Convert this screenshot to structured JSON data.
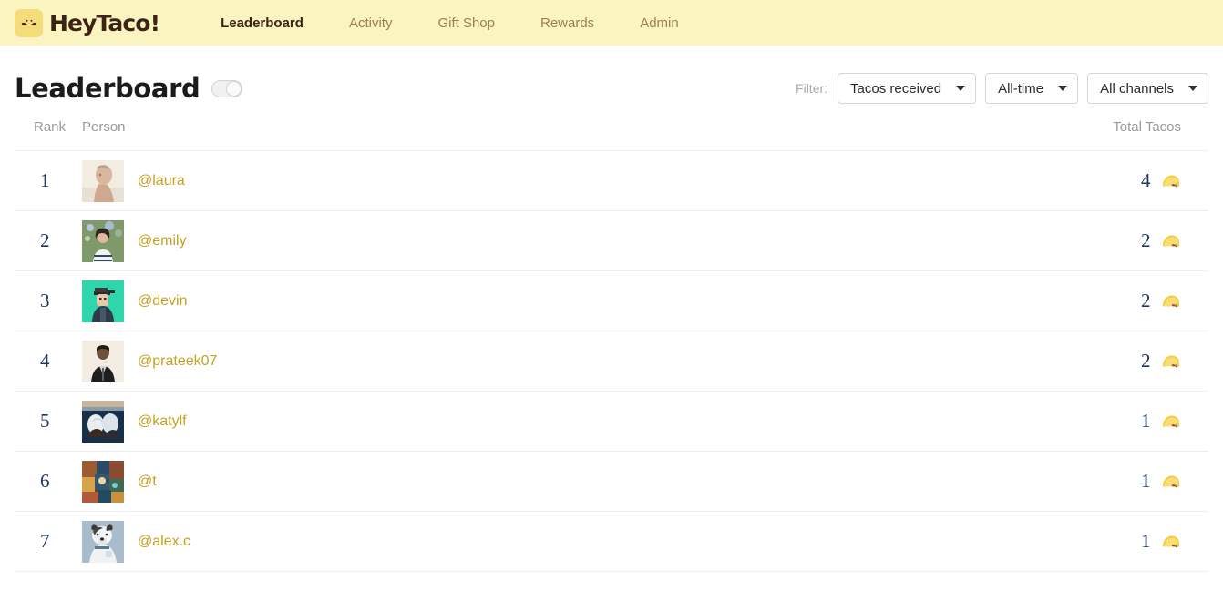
{
  "navbar": {
    "brand_name": "HeyTaco!",
    "logo_icon": "taco-mustache-icon",
    "links": [
      {
        "label": "Leaderboard",
        "active": true
      },
      {
        "label": "Activity",
        "active": false
      },
      {
        "label": "Gift Shop",
        "active": false
      },
      {
        "label": "Rewards",
        "active": false
      },
      {
        "label": "Admin",
        "active": false
      }
    ]
  },
  "page": {
    "title": "Leaderboard",
    "toggle_state": "off"
  },
  "filters": {
    "label": "Filter:",
    "selects": [
      {
        "name": "metric",
        "value": "Tacos received",
        "icon": "chevron-down-icon"
      },
      {
        "name": "timeframe",
        "value": "All-time",
        "icon": "chevron-down-icon"
      },
      {
        "name": "channel",
        "value": "All channels",
        "icon": "chevron-down-icon"
      }
    ]
  },
  "table": {
    "headers": {
      "rank": "Rank",
      "person": "Person",
      "total": "Total Tacos"
    },
    "rows": [
      {
        "rank": "1",
        "name": "@laura",
        "total": "4",
        "taco_icon": "taco-icon",
        "avatar": "statue-bust-avatar"
      },
      {
        "rank": "2",
        "name": "@emily",
        "total": "2",
        "taco_icon": "taco-icon",
        "avatar": "photo-person-flowers-avatar"
      },
      {
        "rank": "3",
        "name": "@devin",
        "total": "2",
        "taco_icon": "taco-icon",
        "avatar": "cartoon-cap-teal-avatar"
      },
      {
        "rank": "4",
        "name": "@prateek07",
        "total": "2",
        "taco_icon": "taco-icon",
        "avatar": "photo-suit-avatar"
      },
      {
        "rank": "5",
        "name": "@katylf",
        "total": "1",
        "taco_icon": "taco-icon",
        "avatar": "painting-lovers-avatar"
      },
      {
        "rank": "6",
        "name": "@t",
        "total": "1",
        "taco_icon": "taco-icon",
        "avatar": "colorful-collage-avatar"
      },
      {
        "rank": "7",
        "name": "@alex.c",
        "total": "1",
        "taco_icon": "taco-icon",
        "avatar": "dog-illustration-avatar"
      }
    ]
  },
  "colors": {
    "navbar_bg": "#faf5c0",
    "brand_text": "#3d2313",
    "nav_inactive": "#9c7f56",
    "username": "#c8a020",
    "rank_text": "#1f3864",
    "header_text": "#9a9a9a",
    "row_border": "#eeeeee",
    "logo_bg": "#f5dc7a"
  }
}
